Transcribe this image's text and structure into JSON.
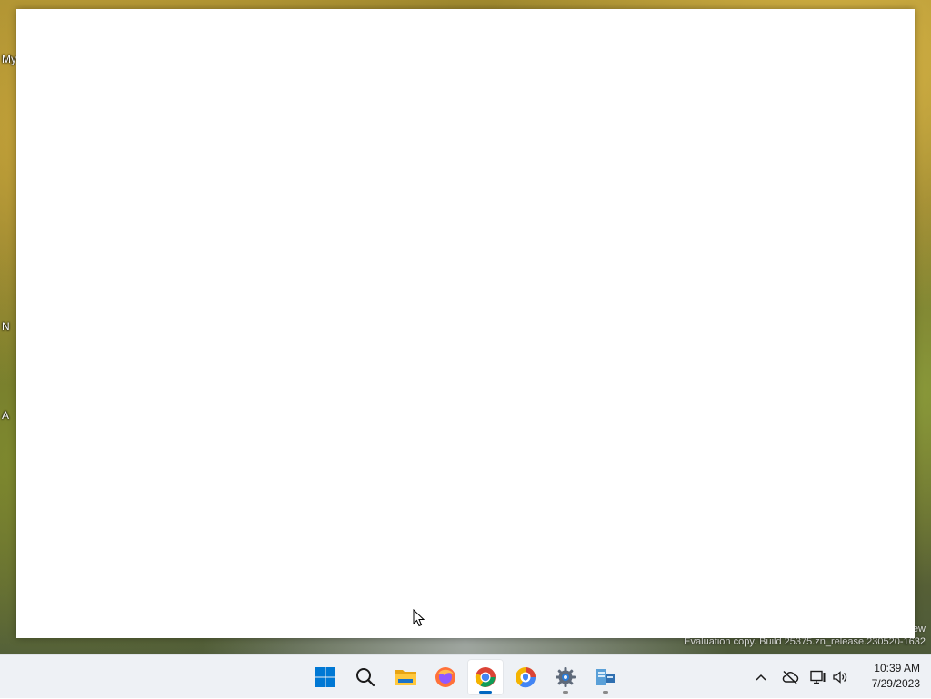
{
  "desktop": {
    "icon_labels": [
      "My",
      "N",
      "A"
    ],
    "watermark_tail": "ew",
    "watermark": "Evaluation copy. Build 25375.zn_release.230520-1632"
  },
  "window": {
    "state": "blank"
  },
  "taskbar": {
    "apps": [
      {
        "name": "Start",
        "icon": "windows-logo-icon",
        "state": "closed"
      },
      {
        "name": "Search",
        "icon": "search-icon",
        "state": "closed"
      },
      {
        "name": "File Explorer",
        "icon": "folder-icon",
        "state": "closed"
      },
      {
        "name": "Firefox",
        "icon": "firefox-icon",
        "state": "closed"
      },
      {
        "name": "Google Chrome",
        "icon": "chrome-icon",
        "state": "active"
      },
      {
        "name": "Chrome Canary-style Browser",
        "icon": "browser-shield-icon",
        "state": "closed"
      },
      {
        "name": "Settings",
        "icon": "gear-icon",
        "state": "open"
      },
      {
        "name": "Server Manager",
        "icon": "server-icon",
        "state": "open"
      }
    ],
    "tray": {
      "overflow_icon": "chevron-up-icon",
      "cloud_icon": "cloud-offline-icon",
      "network_icon": "network-icon",
      "volume_icon": "speaker-icon"
    },
    "clock": {
      "time": "10:39 AM",
      "date": "7/29/2023"
    }
  },
  "colors": {
    "taskbar_bg": "#eef1f5",
    "accent": "#0067c0"
  }
}
